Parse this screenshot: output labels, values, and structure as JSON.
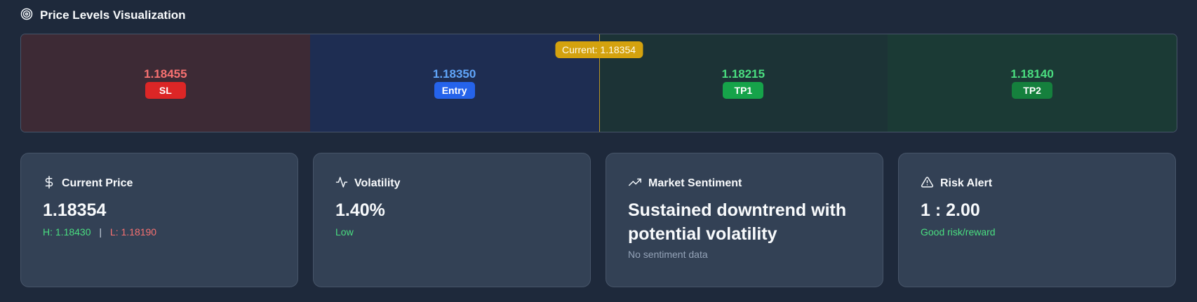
{
  "header": {
    "title": "Price Levels Visualization",
    "icon": "target-icon"
  },
  "levels": [
    {
      "key": "sl",
      "price": "1.18455",
      "label": "SL",
      "bg": "#3d2a35",
      "price_color": "#f87171",
      "badge_bg": "#dc2626"
    },
    {
      "key": "entry",
      "price": "1.18350",
      "label": "Entry",
      "bg": "#1e2d52",
      "price_color": "#60a5fa",
      "badge_bg": "#2563eb"
    },
    {
      "key": "tp1",
      "price": "1.18215",
      "label": "TP1",
      "bg": "#1c3336",
      "price_color": "#4ade80",
      "badge_bg": "#16a34a"
    },
    {
      "key": "tp2",
      "price": "1.18140",
      "label": "TP2",
      "bg": "#1b3a35",
      "price_color": "#4ade80",
      "badge_bg": "#15803d"
    }
  ],
  "current_marker": {
    "label": "Current: 1.18354",
    "position_fraction": 0.5
  },
  "cards": {
    "current_price": {
      "label": "Current Price",
      "icon": "dollar-icon",
      "value": "1.18354",
      "high": "H: 1.18430",
      "separator": "|",
      "low": "L: 1.18190"
    },
    "volatility": {
      "label": "Volatility",
      "icon": "activity-icon",
      "value": "1.40%",
      "level": "Low"
    },
    "sentiment": {
      "label": "Market Sentiment",
      "icon": "trending-up-icon",
      "value": "Sustained downtrend with potential volatility",
      "note": "No sentiment data"
    },
    "risk": {
      "label": "Risk Alert",
      "icon": "alert-triangle-icon",
      "value": "1 : 2.00",
      "note": "Good risk/reward"
    }
  },
  "colors": {
    "page_bg": "#1e293b",
    "card_bg": "#334155",
    "current_marker": "#d4a20e"
  }
}
